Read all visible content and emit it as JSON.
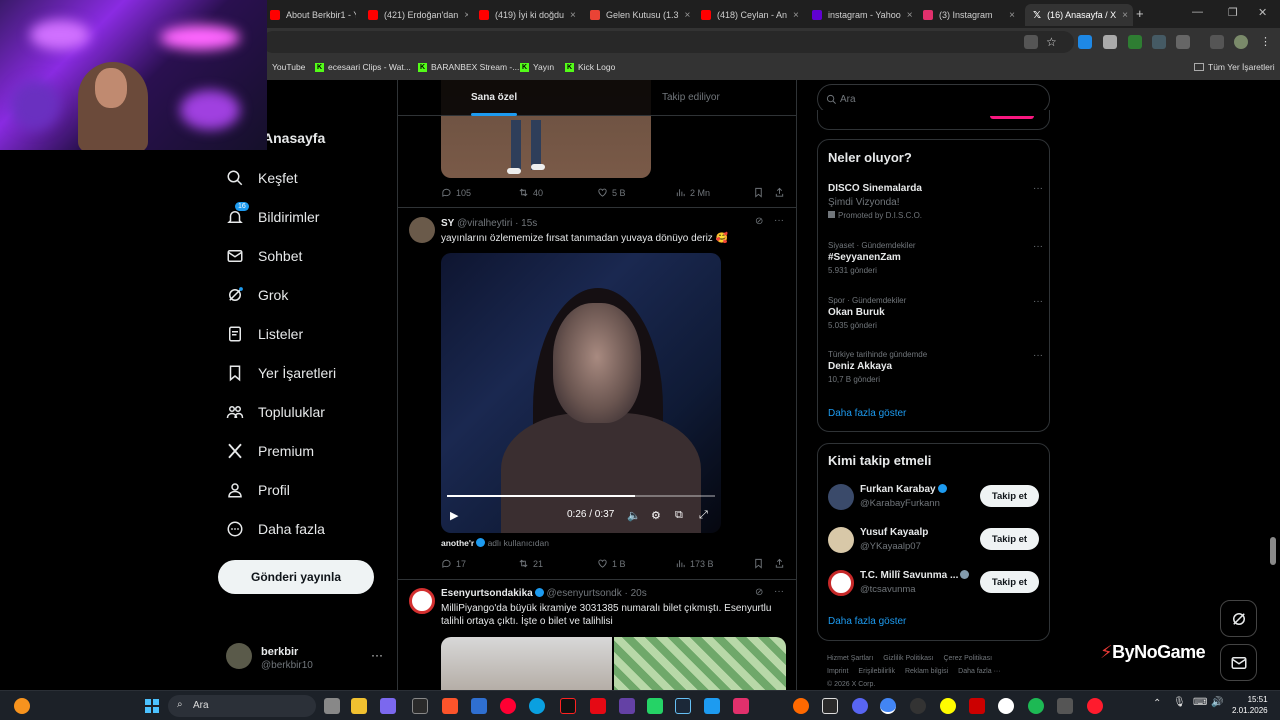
{
  "browser": {
    "tabs": [
      {
        "title": "About Berkbir1 - Y",
        "color": "#ff0000"
      },
      {
        "title": "(421) Erdoğan'dan",
        "color": "#ff0000"
      },
      {
        "title": "(419) İyi ki doğdu",
        "color": "#ff0000"
      },
      {
        "title": "Gelen Kutusu (1.3",
        "color": "#ea4335"
      },
      {
        "title": "(418) Ceylan - An",
        "color": "#ff0000"
      },
      {
        "title": "instagram - Yahoo",
        "color": "#6001d2"
      },
      {
        "title": "(3) Instagram",
        "color": "#e1306c"
      },
      {
        "title": "(16) Anasayfa / X",
        "color": "#ffffff"
      }
    ],
    "new_tab": "+",
    "bookmarks": [
      "YouTube",
      "ecesaari Clips - Wat...",
      "BARANBEX Stream -...",
      "Yayın",
      "Kick Logo"
    ],
    "all_bookmarks": "Tüm Yer İşaretleri"
  },
  "nav": {
    "home": "Anasayfa",
    "items": [
      "Keşfet",
      "Bildirimler",
      "Sohbet",
      "Grok",
      "Listeler",
      "Yer İşaretleri",
      "Topluluklar",
      "Premium",
      "Profil",
      "Daha fazla"
    ],
    "notification_badge": "16",
    "post_button": "Gönderi yayınla",
    "profile_name": "berkbir",
    "profile_handle": "@berkbir10",
    "more_dots": "···"
  },
  "feed": {
    "tabs": [
      "Sana özel",
      "Takip ediliyor"
    ],
    "tweet1_stats": {
      "replies": "105",
      "retweets": "40",
      "likes": "5 B",
      "views": "2 Mn"
    },
    "tweet2": {
      "initials": "SY",
      "handle": "@viralheytiri · 15s",
      "text": "yayınlarını özlememize fırsat tanımadan yuvaya dönüyo deriz 🥰",
      "video_time": "0:26 / 0:37",
      "video_progress": 0.7,
      "attribution_name": "anothe'r",
      "attribution_suffix": "adlı kullanıcıdan",
      "stats": {
        "replies": "17",
        "retweets": "21",
        "likes": "1 B",
        "views": "173 B"
      }
    },
    "tweet3": {
      "name": "Esenyurtsondakika",
      "handle": "@esenyurtsondk · 20s",
      "text": "MilliPiyango'da büyük ikramiye 3031385 numaralı bilet çıkmıştı. Esenyurtlu talihli ortaya çıktı. İşte o bilet ve talihlisi"
    }
  },
  "right": {
    "search_placeholder": "Ara",
    "trends_title": "Neler oluyor?",
    "trends": [
      {
        "context": "Şimdi Vizyonda!",
        "title": "DISCO Sinemalarda",
        "count": "Promoted by D.I.S.C.O."
      },
      {
        "context": "Siyaset · Gündemdekiler",
        "title": "#SeyyanenZam",
        "count": "5.931 gönderi"
      },
      {
        "context": "Spor · Gündemdekiler",
        "title": "Okan Buruk",
        "count": "5.035 gönderi"
      },
      {
        "context": "Türkiye tarihinde gündemde",
        "title": "Deniz Akkaya",
        "count": "10,7 B gönderi"
      }
    ],
    "trends_more": "Daha fazla göster",
    "who_title": "Kimi takip etmeli",
    "who": [
      {
        "name": "Furkan Karabay",
        "handle": "@KarabayFurkann",
        "button": "Takip et"
      },
      {
        "name": "Yusuf Kayaalp",
        "handle": "@YKayaalp07",
        "button": "Takip et"
      },
      {
        "name": "T.C. Millî Savunma ...",
        "handle": "@tcsavunma",
        "button": "Takip et"
      }
    ],
    "who_more": "Daha fazla göster",
    "footer": [
      "Hizmet Şartları",
      "Gizlilik Politikası",
      "Çerez Politikası",
      "Imprint",
      "Erişilebilirlik",
      "Reklam bilgisi",
      "Daha fazla ···",
      "© 2026 X Corp."
    ]
  },
  "watermark": "ByNoGame",
  "taskbar": {
    "search_placeholder": "Ara",
    "time": "15:51",
    "date": "2.01.2026"
  }
}
